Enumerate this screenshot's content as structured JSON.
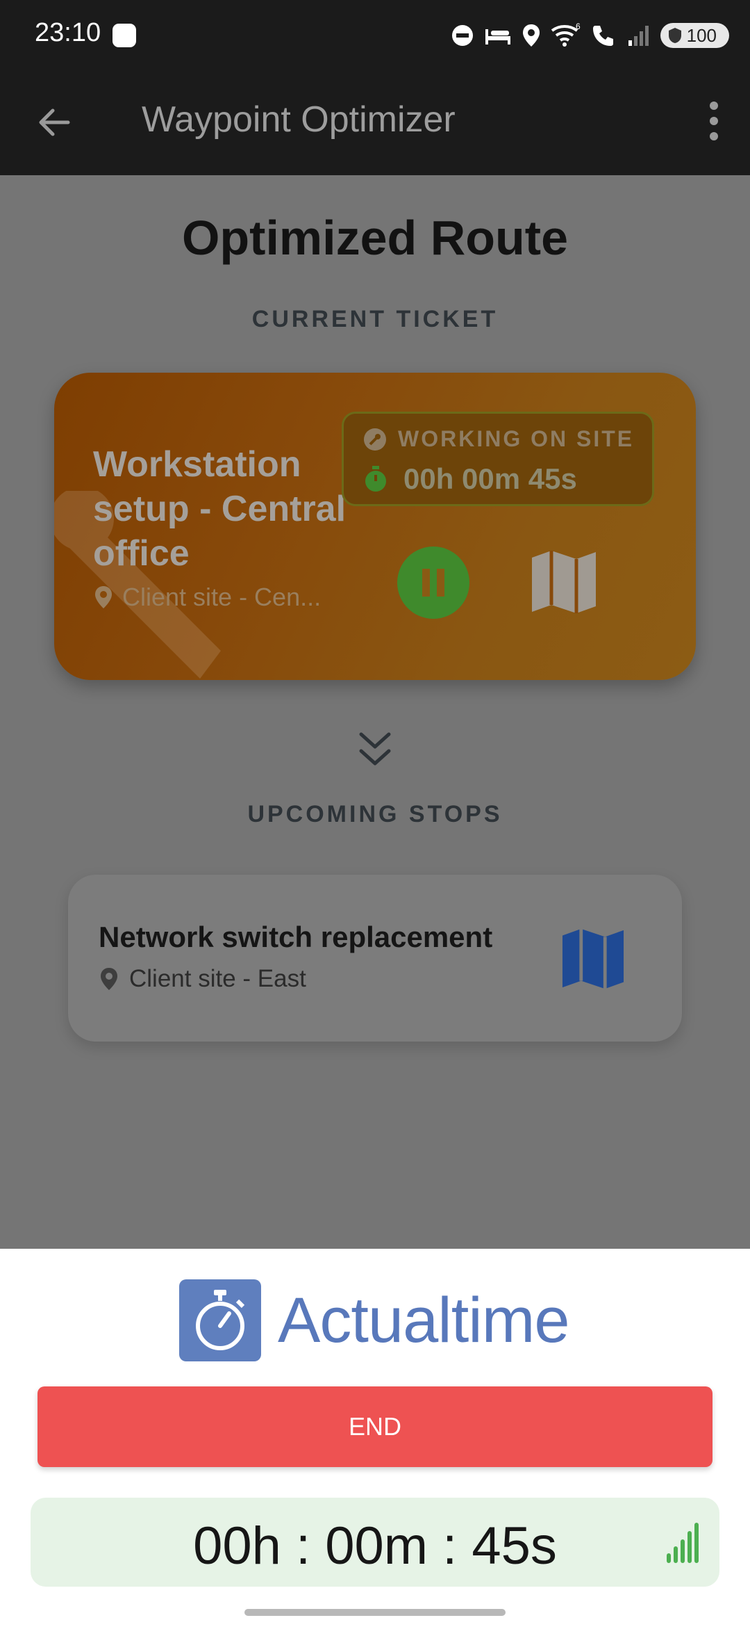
{
  "status_bar": {
    "time": "23:10",
    "battery": "100",
    "icons": [
      "dnd-icon",
      "bed-icon",
      "location-icon",
      "wifi-icon",
      "wifi-calling-icon",
      "signal-icon",
      "battery-icon"
    ]
  },
  "app_bar": {
    "title": "Waypoint Optimizer",
    "back_icon": "arrow-left-icon",
    "menu_icon": "more-vert-icon"
  },
  "page": {
    "title": "Optimized Route",
    "current_ticket_label": "CURRENT TICKET",
    "upcoming_label": "UPCOMING STOPS"
  },
  "current_ticket": {
    "title": "Workstation setup - Central office",
    "location": "Client site - Cen...",
    "status_label": "WORKING ON SITE",
    "elapsed": "00h 00m 45s",
    "colors": {
      "card": "#ff8c00",
      "pause": "#4caf50"
    }
  },
  "upcoming_stops": [
    {
      "title": "Network switch replacement",
      "location": "Client site - East"
    }
  ],
  "timer_sheet": {
    "brand": "Actualtime",
    "end_label": "END",
    "timer": "00h : 00m : 45s",
    "colors": {
      "brand": "#5878bb",
      "end": "#ee5252",
      "timer_bg": "#e6f3e6"
    }
  }
}
